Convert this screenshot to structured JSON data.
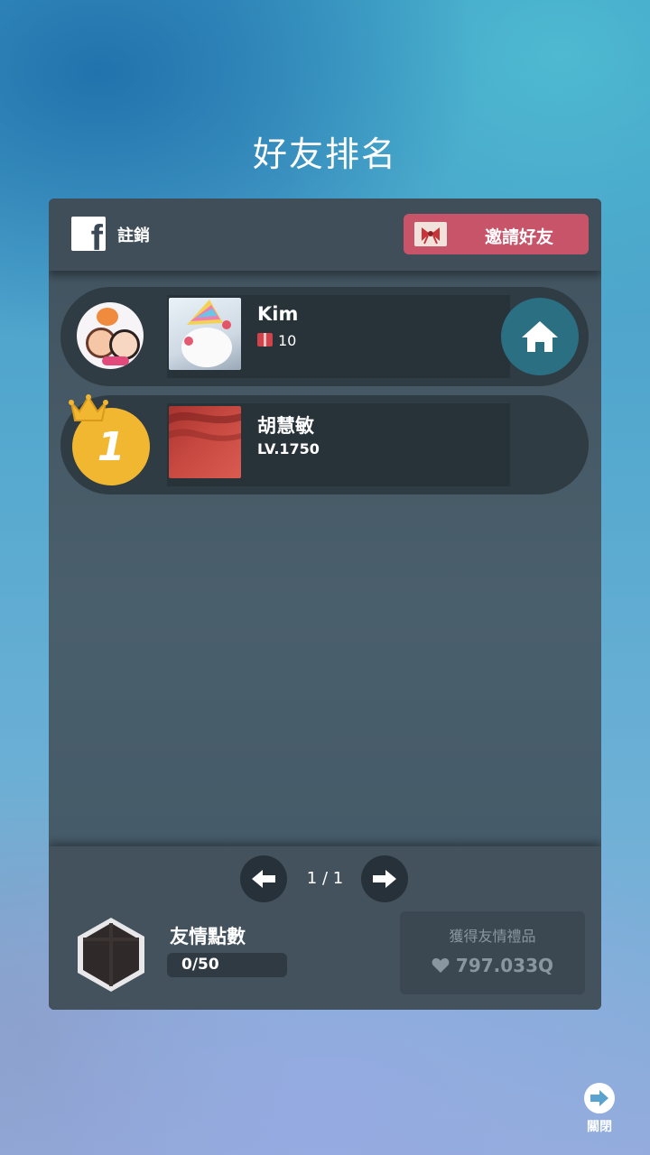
{
  "header": {
    "title": "好友排名"
  },
  "panel": {
    "logout_label": "註銷",
    "invite_label": "邀請好友"
  },
  "friends": [
    {
      "name": "Kim",
      "gifts": "10"
    },
    {
      "rank": "1",
      "name": "胡慧敏",
      "level": "LV.1750"
    }
  ],
  "pagination": {
    "page": "1 / 1"
  },
  "friend_points": {
    "label": "友情點數",
    "value": "0/50",
    "progress": 0
  },
  "gift_reward": {
    "label": "獲得友情禮品",
    "value": "797.033Q"
  },
  "close": {
    "label": "關閉"
  },
  "icons": [
    "facebook-icon",
    "gift-icon",
    "home-icon",
    "crown-icon",
    "arrow-left-icon",
    "arrow-right-icon",
    "gift-box-icon",
    "heart-icon",
    "arrow-right-circle-icon"
  ]
}
